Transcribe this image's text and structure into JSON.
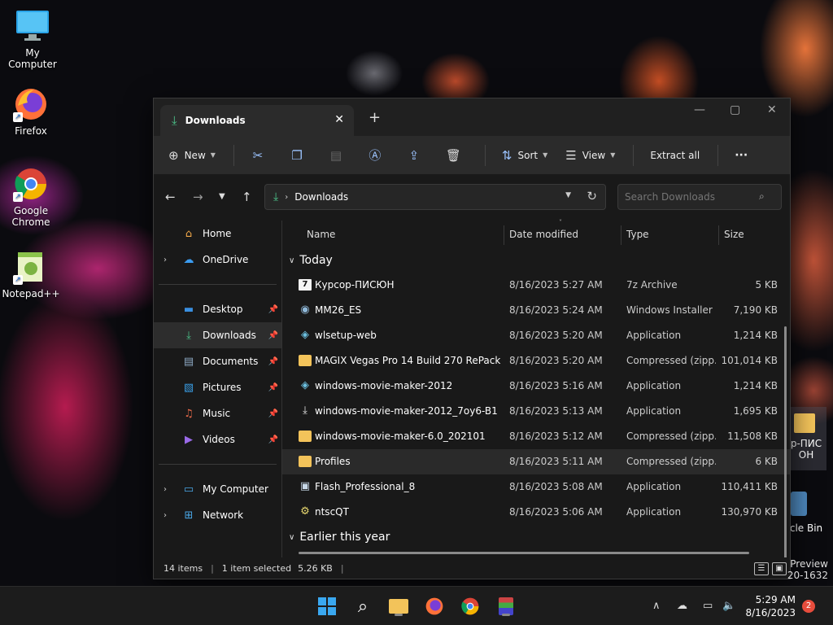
{
  "desktop": {
    "icons": [
      {
        "label": "My Computer",
        "icon": "monitor-icon"
      },
      {
        "label": "Firefox",
        "icon": "firefox-icon"
      },
      {
        "label": "Google Chrome",
        "icon": "chrome-icon"
      },
      {
        "label": "Notepad++",
        "icon": "notepadpp-icon"
      }
    ],
    "partial_right": {
      "file_label": "р-ПИС ОН",
      "recycle_label": "cle Bin"
    }
  },
  "window": {
    "tab_title": "Downloads",
    "toolbar": {
      "new_label": "New",
      "sort_label": "Sort",
      "view_label": "View",
      "extract_label": "Extract all",
      "more_label": "···"
    },
    "address": {
      "path": "Downloads"
    },
    "search": {
      "placeholder": "Search Downloads"
    },
    "sidebar": {
      "top": [
        {
          "label": "Home",
          "icon": "home-icon",
          "expandable": false
        },
        {
          "label": "OneDrive",
          "icon": "cloud-icon",
          "expandable": true
        }
      ],
      "quick": [
        {
          "label": "Desktop",
          "icon": "desktop-icon",
          "pinned": true,
          "selected": false
        },
        {
          "label": "Downloads",
          "icon": "download-icon",
          "pinned": true,
          "selected": true
        },
        {
          "label": "Documents",
          "icon": "document-icon",
          "pinned": true,
          "selected": false
        },
        {
          "label": "Pictures",
          "icon": "picture-icon",
          "pinned": true,
          "selected": false
        },
        {
          "label": "Music",
          "icon": "music-icon",
          "pinned": true,
          "selected": false
        },
        {
          "label": "Videos",
          "icon": "video-icon",
          "pinned": true,
          "selected": false
        }
      ],
      "bottom": [
        {
          "label": "My Computer",
          "icon": "monitor-icon",
          "expandable": true
        },
        {
          "label": "Network",
          "icon": "network-icon",
          "expandable": true
        }
      ]
    },
    "columns": {
      "name": "Name",
      "date": "Date modified",
      "type": "Type",
      "size": "Size"
    },
    "groups": {
      "today": "Today",
      "earlier": "Earlier this year"
    },
    "files": [
      {
        "name": "Курсор-ПИСЮН",
        "date": "8/16/2023 5:27 AM",
        "type": "7z Archive",
        "size": "5 KB",
        "icon": "7z-archive-icon"
      },
      {
        "name": "MM26_ES",
        "date": "8/16/2023 5:24 AM",
        "type": "Windows Installer ...",
        "size": "7,190 KB",
        "icon": "installer-icon"
      },
      {
        "name": "wlsetup-web",
        "date": "8/16/2023 5:20 AM",
        "type": "Application",
        "size": "1,214 KB",
        "icon": "setup-app-icon"
      },
      {
        "name": "MAGIX Vegas Pro 14 Build 270 RePack by ...",
        "date": "8/16/2023 5:20 AM",
        "type": "Compressed (zipp...",
        "size": "101,014 KB",
        "icon": "zip-folder-icon"
      },
      {
        "name": "windows-movie-maker-2012",
        "date": "8/16/2023 5:16 AM",
        "type": "Application",
        "size": "1,214 KB",
        "icon": "setup-app-icon"
      },
      {
        "name": "windows-movie-maker-2012_7oy6-B1",
        "date": "8/16/2023 5:13 AM",
        "type": "Application",
        "size": "1,695 KB",
        "icon": "download-app-icon"
      },
      {
        "name": "windows-movie-maker-6.0_202101",
        "date": "8/16/2023 5:12 AM",
        "type": "Compressed (zipp...",
        "size": "11,508 KB",
        "icon": "zip-folder-icon"
      },
      {
        "name": "Profiles",
        "date": "8/16/2023 5:11 AM",
        "type": "Compressed (zipp...",
        "size": "6 KB",
        "icon": "zip-folder-icon"
      },
      {
        "name": "Flash_Professional_8",
        "date": "8/16/2023 5:08 AM",
        "type": "Application",
        "size": "110,411 KB",
        "icon": "app-window-icon"
      },
      {
        "name": "ntscQT",
        "date": "8/16/2023 5:06 AM",
        "type": "Application",
        "size": "130,970 KB",
        "icon": "app-gear-icon"
      }
    ],
    "selected_row": 7,
    "status": {
      "items": "14 items",
      "selected": "1 item selected",
      "size": "5.26 KB"
    }
  },
  "taskbar": {
    "clock_time": "5:29 AM",
    "clock_date": "8/16/2023",
    "notification_count": "2",
    "watermark_line1": "Preview",
    "watermark_line2": "20-1632"
  },
  "colors": {
    "accent": "#4cc38a",
    "folder": "#f3c35a",
    "bg": "#191919"
  }
}
